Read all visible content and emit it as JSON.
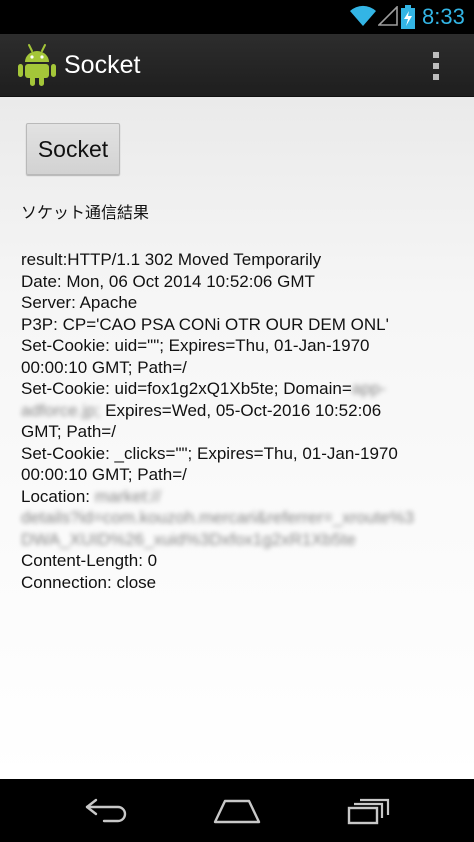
{
  "status_bar": {
    "time": "8:33",
    "clock_color": "#33b5e5",
    "icons": [
      "wifi-icon",
      "signal-icon",
      "battery-charging-icon"
    ]
  },
  "action_bar": {
    "title": "Socket",
    "app_icon": "android-robot-icon",
    "menu_icon": "overflow-menu-icon"
  },
  "main": {
    "button_label": "Socket",
    "result_heading": "ソケット通信結果",
    "lines": [
      {
        "text": "result:HTTP/1.1 302 Moved Temporarily"
      },
      {
        "text": "Date: Mon, 06 Oct 2014 10:52:06 GMT"
      },
      {
        "text": "Server: Apache"
      },
      {
        "text": "P3P: CP='CAO PSA CONi OTR OUR DEM ONL'"
      },
      {
        "text": "Set-Cookie: uid=\"\"; Expires=Thu, 01-Jan-1970"
      },
      {
        "text": "00:00:10 GMT; Path=/"
      },
      {
        "text": "Set-Cookie: uid=fox1g2xQ1Xb5te; Domain=",
        "blur": "app-"
      },
      {
        "blur": "adforce.jp;",
        "text": " Expires=Wed, 05-Oct-2016 10:52:06"
      },
      {
        "text": "GMT; Path=/"
      },
      {
        "text": "Set-Cookie: _clicks=\"\"; Expires=Thu, 01-Jan-1970"
      },
      {
        "text": "00:00:10 GMT; Path=/"
      },
      {
        "text": "Location: ",
        "blur": "market://"
      },
      {
        "blur": "details?id=com.kouzoh.mercari&referrer=_xroute%3"
      },
      {
        "blur": "DWA_XUID%26_xuid%3Dxfox1g2xR1Xb5te"
      },
      {
        "text": "Content-Length: 0"
      },
      {
        "text": "Connection: close"
      }
    ]
  },
  "nav_bar": {
    "icons": [
      "back-icon",
      "home-icon",
      "recent-apps-icon"
    ]
  }
}
